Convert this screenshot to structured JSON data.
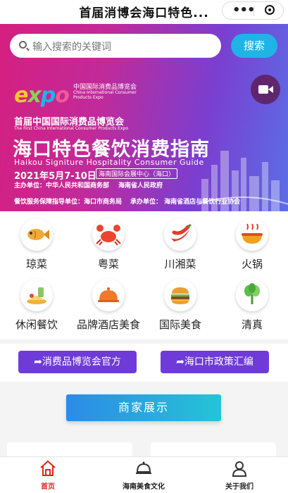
{
  "header": {
    "title": "首届消博会海口特色..."
  },
  "search": {
    "placeholder": "输入搜索的关键词",
    "button_label": "搜索"
  },
  "banner": {
    "logo_text": [
      "e",
      "x",
      "p",
      "o"
    ],
    "org_cn": "中国国际消费品博览会",
    "org_en": "China International Consumer Products Expo",
    "line1": "首届中国国际消费品博览会",
    "line1_en": "The First China International Consumer Products Expo",
    "main_title": "海口特色餐饮消费指南",
    "main_title_en": "Haikou Signiture Hospitality Consumer Guide",
    "date": "2021年5月7-10日",
    "venue": "海南国际会展中心（海口）",
    "host": "主办单位：中华人民共和国商务部",
    "host2": "海南省人民政府",
    "support": "餐饮服务保障指导单位：海口市商务局",
    "support2": "承办单位：    海南省酒店与餐饮行业协会"
  },
  "categories": [
    {
      "label": "琼菜",
      "icon": "fish-icon"
    },
    {
      "label": "粤菜",
      "icon": "crab-icon"
    },
    {
      "label": "川湘菜",
      "icon": "chili-icon"
    },
    {
      "label": "火锅",
      "icon": "hotpot-icon"
    },
    {
      "label": "休闲餐饮",
      "icon": "dessert-icon"
    },
    {
      "label": "品牌酒店美食",
      "icon": "cloche-icon"
    },
    {
      "label": "国际美食",
      "icon": "burger-icon"
    },
    {
      "label": "清真",
      "icon": "vegetable-icon"
    }
  ],
  "links": {
    "expo_official": "消费品博览会官方",
    "haikou_policy": "海口市政策汇编"
  },
  "showcase": {
    "title": "商家展示"
  },
  "tabs": [
    {
      "label": "首页",
      "active": true
    },
    {
      "label": "海南美食文化",
      "active": false
    },
    {
      "label": "关于我们",
      "active": false
    }
  ],
  "colors": {
    "accent_red": "#e1251b",
    "link_purple": "#6f3bd8",
    "search_blue": "#1fb4e6"
  }
}
